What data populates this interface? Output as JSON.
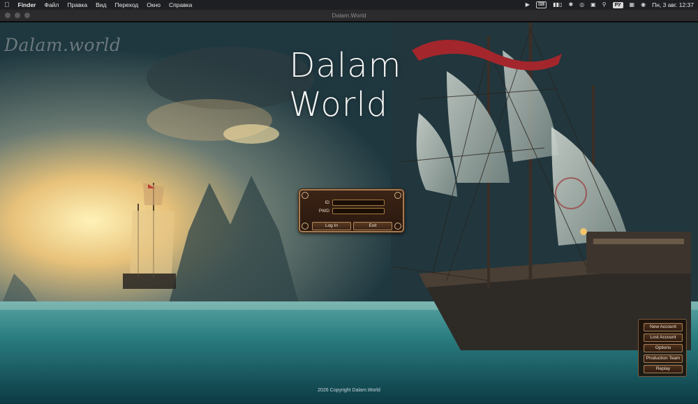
{
  "menubar": {
    "apple_icon": "apple-icon",
    "app_name": "Finder",
    "items": [
      "Файл",
      "Правка",
      "Вид",
      "Переход",
      "Окно",
      "Справка"
    ],
    "status_icons": [
      "play-icon",
      "keyboard-badge-icon",
      "battery-icon",
      "bluetooth-icon",
      "airdrop-icon",
      "screen-mirroring-icon",
      "search-icon"
    ],
    "input_language": "РУ",
    "clock": "Пн, 3 авг.  12:37"
  },
  "window": {
    "title": "Dalam.World"
  },
  "game": {
    "watermark": "Dalam.world",
    "logo_line1": "Dalam",
    "logo_line2": "World",
    "login": {
      "id_label": "ID",
      "pwd_label": "PWD",
      "id_value": "",
      "pwd_value": "",
      "login_button": "Log In",
      "exit_button": "Exit"
    },
    "side_menu": [
      "New Account",
      "Lost Account",
      "Options",
      "Production Team",
      "Replay"
    ],
    "copyright": "2026 Copyright Dalam.World"
  },
  "colors": {
    "menubar_bg": "#1e1f22",
    "panel_border": "#a57a52",
    "panel_bg": "#2a170d",
    "sea": "#1e6f72",
    "sky_glow": "#f5d68a"
  }
}
